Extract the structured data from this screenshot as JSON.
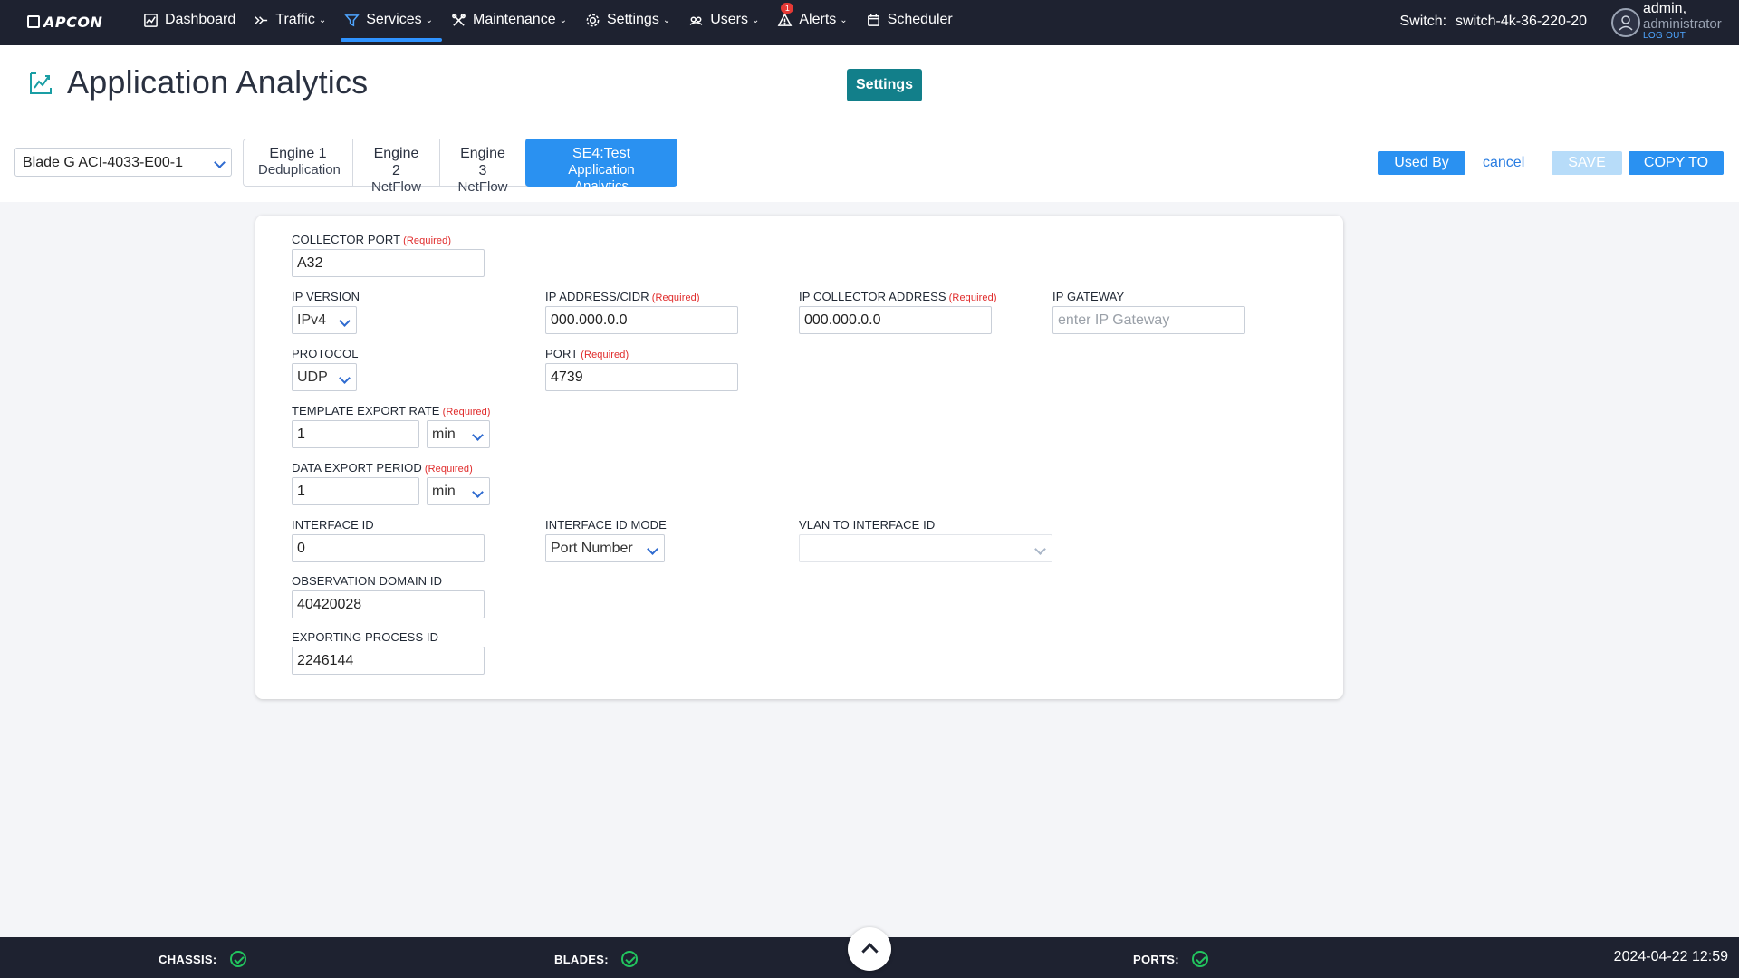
{
  "brand": "APCON",
  "nav": [
    {
      "label": "Dashboard",
      "icon": "dashboard-icon",
      "dropdown": false
    },
    {
      "label": "Traffic",
      "icon": "traffic-icon",
      "dropdown": true
    },
    {
      "label": "Services",
      "icon": "services-icon",
      "dropdown": true,
      "active": true
    },
    {
      "label": "Maintenance",
      "icon": "maintenance-icon",
      "dropdown": true
    },
    {
      "label": "Settings",
      "icon": "gear-icon",
      "dropdown": true
    },
    {
      "label": "Users",
      "icon": "users-icon",
      "dropdown": true
    },
    {
      "label": "Alerts",
      "icon": "alert-icon",
      "dropdown": true,
      "badge": "1"
    },
    {
      "label": "Scheduler",
      "icon": "calendar-icon",
      "dropdown": false
    }
  ],
  "switch": {
    "label": "Switch:",
    "name": "switch-4k-36-220-20"
  },
  "user": {
    "name": "admin,",
    "role": "administrator",
    "logout": "LOG OUT"
  },
  "page": {
    "title": "Application Analytics",
    "settings_button": "Settings"
  },
  "blade_select": {
    "value": "Blade G ACI-4033-E00-1"
  },
  "engine_tabs": [
    {
      "title": "Engine 1",
      "sub": "Deduplication",
      "active": false
    },
    {
      "title": "Engine 2",
      "sub": "NetFlow",
      "active": false
    },
    {
      "title": "Engine 3",
      "sub": "NetFlow",
      "active": false
    },
    {
      "title": "SE4:Test",
      "sub": "Application Analytics",
      "active": true
    }
  ],
  "actions": {
    "used_by": "Used By",
    "cancel": "cancel",
    "save": "SAVE",
    "copy_to": "COPY TO"
  },
  "required_tag": "(Required)",
  "form": {
    "collector_port": {
      "label": "COLLECTOR PORT",
      "value": "A32"
    },
    "ip_version": {
      "label": "IP VERSION",
      "value": "IPv4"
    },
    "ip_address_cidr": {
      "label": "IP ADDRESS/CIDR",
      "value": "000.000.0.0"
    },
    "ip_collector_address": {
      "label": "IP COLLECTOR ADDRESS",
      "value": "000.000.0.0"
    },
    "ip_gateway": {
      "label": "IP GATEWAY",
      "placeholder": "enter IP Gateway"
    },
    "protocol": {
      "label": "PROTOCOL",
      "value": "UDP"
    },
    "port": {
      "label": "PORT",
      "value": "4739"
    },
    "template_export_rate": {
      "label": "TEMPLATE EXPORT RATE",
      "value": "1",
      "unit": "min"
    },
    "data_export_period": {
      "label": "DATA EXPORT PERIOD",
      "value": "1",
      "unit": "min"
    },
    "interface_id": {
      "label": "INTERFACE ID",
      "value": "0"
    },
    "interface_id_mode": {
      "label": "INTERFACE ID MODE",
      "value": "Port Number"
    },
    "vlan_to_interface_id": {
      "label": "VLAN TO INTERFACE ID",
      "value": ""
    },
    "observation_domain_id": {
      "label": "OBSERVATION DOMAIN ID",
      "value": "40420028"
    },
    "exporting_process_id": {
      "label": "EXPORTING PROCESS ID",
      "value": "2246144"
    }
  },
  "status": {
    "chassis": "CHASSIS:",
    "blades": "BLADES:",
    "ports": "PORTS:",
    "datetime": "2024-04-22 12:59"
  },
  "colors": {
    "nav_bg": "#1e2230",
    "accent": "#2a91f1",
    "teal": "#127f8a",
    "required": "#e02b2b",
    "ok": "#22c55e"
  }
}
